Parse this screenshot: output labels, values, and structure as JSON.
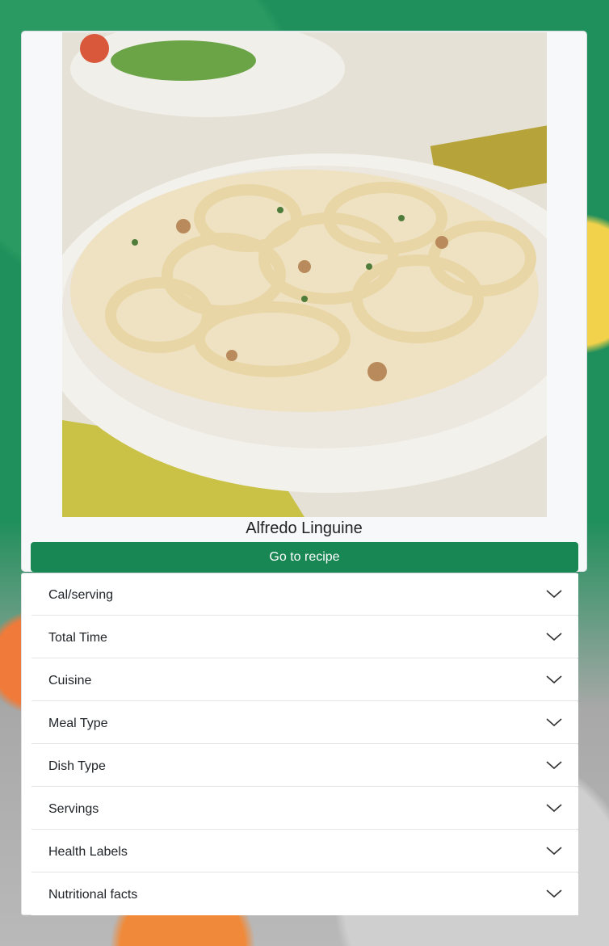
{
  "recipe": {
    "title": "Alfredo Linguine",
    "button_label": "Go to recipe",
    "image_alt": "Alfredo Linguine"
  },
  "accordion": {
    "items": [
      {
        "label": "Cal/serving"
      },
      {
        "label": "Total Time"
      },
      {
        "label": "Cuisine"
      },
      {
        "label": "Meal Type"
      },
      {
        "label": "Dish Type"
      },
      {
        "label": "Servings"
      },
      {
        "label": "Health Labels"
      },
      {
        "label": "Nutritional facts"
      }
    ],
    "icon": "chevron-down-icon"
  },
  "colors": {
    "accent": "#198754",
    "card_bg": "#f7f8fa",
    "text": "#212529"
  }
}
